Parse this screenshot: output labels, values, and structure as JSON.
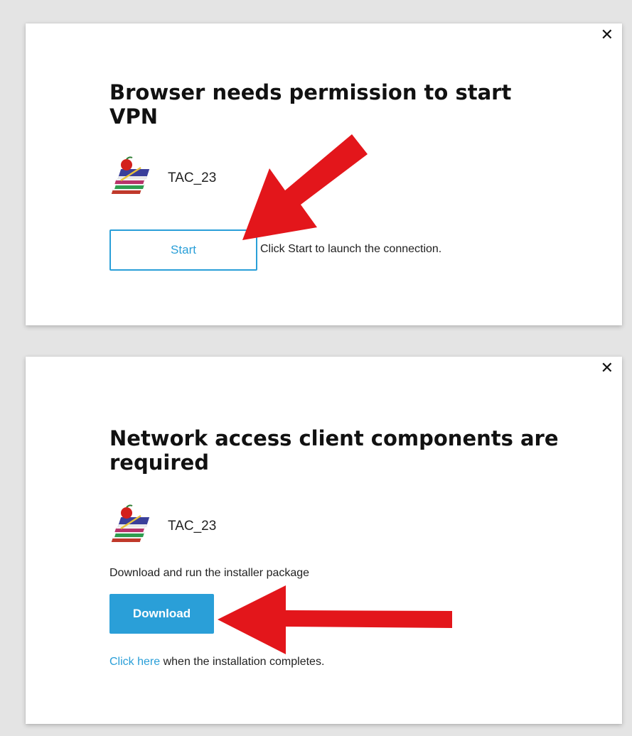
{
  "dialogs": [
    {
      "close_label": "✕",
      "title": "Browser needs permission to start VPN",
      "app_name": "TAC_23",
      "start_button_label": "Start",
      "hint_text": "Click Start to launch the connection."
    },
    {
      "close_label": "✕",
      "title": "Network access client components are required",
      "app_name": "TAC_23",
      "instruction": "Download and run the installer package",
      "download_button_label": "Download",
      "click_here_link": "Click here",
      "completion_text": " when the installation completes."
    }
  ],
  "colors": {
    "page_background": "#e4e4e4",
    "accent": "#2a9fd8",
    "annotation_arrow": "#e3161b"
  },
  "icons": {
    "close": "close-icon",
    "app": "app-books-apple-icon"
  }
}
